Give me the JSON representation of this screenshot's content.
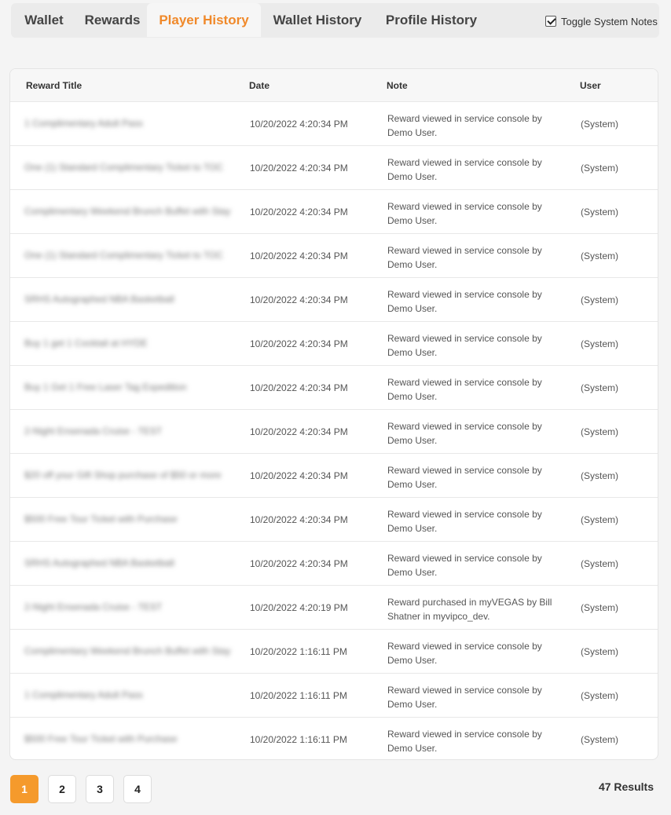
{
  "tabs": [
    {
      "label": "Wallet",
      "active": false
    },
    {
      "label": "Rewards",
      "active": false
    },
    {
      "label": "Player History",
      "active": true
    },
    {
      "label": "Wallet History",
      "active": false
    },
    {
      "label": "Profile History",
      "active": false
    }
  ],
  "toggle": {
    "label": "Toggle System Notes",
    "checked": true
  },
  "table": {
    "headers": {
      "title": "Reward Title",
      "date": "Date",
      "note": "Note",
      "user": "User"
    },
    "rows": [
      {
        "title": "1 Complimentary Adult Pass",
        "date": "10/20/2022 4:20:34 PM",
        "note": "Reward viewed in service console by Demo User.",
        "user": "(System)"
      },
      {
        "title": "One (1) Standard Complimentary Ticket to TOC",
        "date": "10/20/2022 4:20:34 PM",
        "note": "Reward viewed in service console by Demo User.",
        "user": "(System)"
      },
      {
        "title": "Complimentary Weekend Brunch Buffet with Stay",
        "date": "10/20/2022 4:20:34 PM",
        "note": "Reward viewed in service console by Demo User.",
        "user": "(System)"
      },
      {
        "title": "One (1) Standard Complimentary Ticket to TOC",
        "date": "10/20/2022 4:20:34 PM",
        "note": "Reward viewed in service console by Demo User.",
        "user": "(System)"
      },
      {
        "title": "SRHS Autographed NBA Basketball",
        "date": "10/20/2022 4:20:34 PM",
        "note": "Reward viewed in service console by Demo User.",
        "user": "(System)"
      },
      {
        "title": "Buy 1 get 1 Cocktail at HYDE",
        "date": "10/20/2022 4:20:34 PM",
        "note": "Reward viewed in service console by Demo User.",
        "user": "(System)"
      },
      {
        "title": "Buy 1 Get 1 Free Laser Tag Expedition",
        "date": "10/20/2022 4:20:34 PM",
        "note": "Reward viewed in service console by Demo User.",
        "user": "(System)"
      },
      {
        "title": "2-Night Ensenada Cruise - TEST",
        "date": "10/20/2022 4:20:34 PM",
        "note": "Reward viewed in service console by Demo User.",
        "user": "(System)"
      },
      {
        "title": "$20 off your Gift Shop purchase of $50 or more",
        "date": "10/20/2022 4:20:34 PM",
        "note": "Reward viewed in service console by Demo User.",
        "user": "(System)"
      },
      {
        "title": "$500 Free Tour Ticket with Purchase",
        "date": "10/20/2022 4:20:34 PM",
        "note": "Reward viewed in service console by Demo User.",
        "user": "(System)"
      },
      {
        "title": "SRHS Autographed NBA Basketball",
        "date": "10/20/2022 4:20:34 PM",
        "note": "Reward viewed in service console by Demo User.",
        "user": "(System)"
      },
      {
        "title": "2-Night Ensenada Cruise - TEST",
        "date": "10/20/2022 4:20:19 PM",
        "note": "Reward purchased in myVEGAS by Bill Shatner in myvipco_dev.",
        "user": "(System)"
      },
      {
        "title": "Complimentary Weekend Brunch Buffet with Stay",
        "date": "10/20/2022 1:16:11 PM",
        "note": "Reward viewed in service console by Demo User.",
        "user": "(System)"
      },
      {
        "title": "1 Complimentary Adult Pass",
        "date": "10/20/2022 1:16:11 PM",
        "note": "Reward viewed in service console by Demo User.",
        "user": "(System)"
      },
      {
        "title": "$500 Free Tour Ticket with Purchase",
        "date": "10/20/2022 1:16:11 PM",
        "note": "Reward viewed in service console by Demo User.",
        "user": "(System)"
      }
    ]
  },
  "pagination": {
    "pages": [
      "1",
      "2",
      "3",
      "4"
    ],
    "current": "1"
  },
  "results": "47 Results",
  "colors": {
    "accent": "#f0892a",
    "active_page": "#f59a2c"
  }
}
